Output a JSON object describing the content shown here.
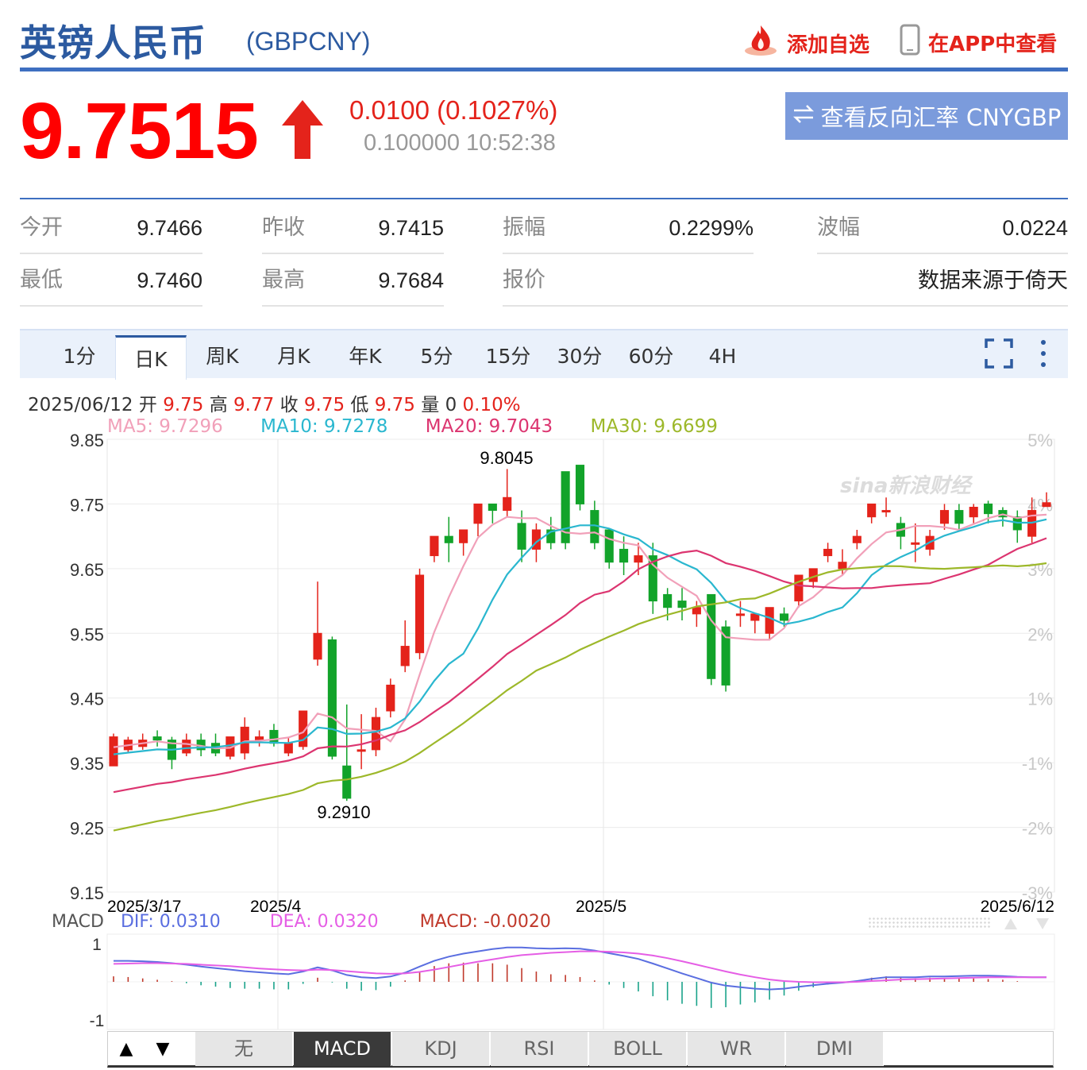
{
  "header": {
    "title": "英镑人民币",
    "code": "(GBPCNY)",
    "add_label": "添加自选",
    "app_label": "在APP中查看"
  },
  "quote": {
    "price": "9.7515",
    "change": "0.0100 (0.1027%)",
    "sub": "0.100000 10:52:38",
    "reverse_label": "查看反向汇率 CNYGBP"
  },
  "stats": [
    {
      "label": "今开",
      "value": "9.7466"
    },
    {
      "label": "昨收",
      "value": "9.7415"
    },
    {
      "label": "振幅",
      "value": "0.2299%"
    },
    {
      "label": "波幅",
      "value": "0.0224"
    },
    {
      "label": "最低",
      "value": "9.7460"
    },
    {
      "label": "最高",
      "value": "9.7684"
    },
    {
      "label": "报价",
      "value": ""
    },
    {
      "label": "",
      "value": "数据来源于倚天"
    }
  ],
  "tabs": [
    "1分",
    "日K",
    "周K",
    "月K",
    "年K",
    "5分",
    "15分",
    "30分",
    "60分",
    "4H"
  ],
  "active_tab": "日K",
  "info": {
    "date": "2025/06/12",
    "open_label": "开",
    "open": "9.75",
    "high_label": "高",
    "high": "9.77",
    "close_label": "收",
    "close": "9.75",
    "low_label": "低",
    "low": "9.75",
    "vol_label": "量",
    "vol": "0",
    "pct": "0.10%"
  },
  "ma": [
    {
      "label": "MA5: 9.7296",
      "color": "#f1a0b9"
    },
    {
      "label": "MA10: 9.7278",
      "color": "#2ab7cf"
    },
    {
      "label": "MA20: 9.7043",
      "color": "#dc3570"
    },
    {
      "label": "MA30: 9.6699",
      "color": "#9db82a"
    }
  ],
  "macd_legend": {
    "name": "MACD",
    "dif": "DIF: 0.0310",
    "dea": "DEA: 0.0320",
    "macd": "MACD: -0.0020",
    "dif_color": "#5a6ee0",
    "dea_color": "#e55ee5",
    "macd_color": "#c0392b"
  },
  "indicator_buttons": [
    "无",
    "MACD",
    "KDJ",
    "RSI",
    "BOLL",
    "WR",
    "DMI"
  ],
  "active_indicator": "MACD",
  "chart_data": {
    "type": "candlestick",
    "y_ticks": [
      "9.85",
      "9.75",
      "9.65",
      "9.55",
      "9.45",
      "9.35",
      "9.25",
      "9.15"
    ],
    "pct_ticks": [
      "5%",
      "4%",
      "3%",
      "2%",
      "1%",
      "-1%",
      "-2%",
      "-3%"
    ],
    "x_ticks": [
      "2025/3/17",
      "2025/4",
      "2025/5",
      "2025/6/12"
    ],
    "macd_ticks": [
      "1",
      "-1"
    ],
    "high_mark": "9.8045",
    "low_mark": "9.2910",
    "watermark": "sina新浪财经",
    "ylim": [
      9.15,
      9.85
    ],
    "candles": [
      [
        9.345,
        9.395,
        9.39,
        9.345
      ],
      [
        9.37,
        9.39,
        9.385,
        9.365
      ],
      [
        9.375,
        9.395,
        9.385,
        9.37
      ],
      [
        9.39,
        9.4,
        9.385,
        9.375
      ],
      [
        9.385,
        9.39,
        9.355,
        9.34
      ],
      [
        9.365,
        9.395,
        9.385,
        9.36
      ],
      [
        9.385,
        9.395,
        9.37,
        9.36
      ],
      [
        9.38,
        9.395,
        9.365,
        9.36
      ],
      [
        9.36,
        9.385,
        9.39,
        9.355
      ],
      [
        9.365,
        9.42,
        9.405,
        9.355
      ],
      [
        9.385,
        9.4,
        9.39,
        9.375
      ],
      [
        9.4,
        9.41,
        9.38,
        9.375
      ],
      [
        9.365,
        9.39,
        9.38,
        9.36
      ],
      [
        9.375,
        9.425,
        9.43,
        9.37
      ],
      [
        9.51,
        9.63,
        9.55,
        9.5
      ],
      [
        9.54,
        9.545,
        9.36,
        9.355
      ],
      [
        9.345,
        9.44,
        9.295,
        9.291
      ],
      [
        9.37,
        9.425,
        9.37,
        9.34
      ],
      [
        9.37,
        9.435,
        9.42,
        9.36
      ],
      [
        9.43,
        9.48,
        9.47,
        9.42
      ],
      [
        9.5,
        9.57,
        9.53,
        9.49
      ],
      [
        9.52,
        9.65,
        9.64,
        9.51
      ],
      [
        9.67,
        9.69,
        9.7,
        9.66
      ],
      [
        9.7,
        9.73,
        9.69,
        9.66
      ],
      [
        9.69,
        9.7,
        9.71,
        9.67
      ],
      [
        9.72,
        9.74,
        9.75,
        9.7
      ],
      [
        9.75,
        9.75,
        9.74,
        9.72
      ],
      [
        9.74,
        9.804,
        9.76,
        9.73
      ],
      [
        9.72,
        9.74,
        9.68,
        9.66
      ],
      [
        9.68,
        9.72,
        9.71,
        9.66
      ],
      [
        9.71,
        9.73,
        9.69,
        9.68
      ],
      [
        9.8,
        9.8,
        9.69,
        9.68
      ],
      [
        9.81,
        9.81,
        9.75,
        9.74
      ],
      [
        9.74,
        9.755,
        9.69,
        9.68
      ],
      [
        9.71,
        9.71,
        9.66,
        9.65
      ],
      [
        9.68,
        9.7,
        9.66,
        9.64
      ],
      [
        9.66,
        9.69,
        9.67,
        9.64
      ],
      [
        9.67,
        9.69,
        9.6,
        9.58
      ],
      [
        9.61,
        9.62,
        9.59,
        9.57
      ],
      [
        9.6,
        9.62,
        9.59,
        9.57
      ],
      [
        9.58,
        9.6,
        9.59,
        9.56
      ],
      [
        9.61,
        9.61,
        9.48,
        9.47
      ],
      [
        9.56,
        9.57,
        9.47,
        9.46
      ],
      [
        9.58,
        9.6,
        9.58,
        9.56
      ],
      [
        9.57,
        9.58,
        9.58,
        9.55
      ],
      [
        9.55,
        9.57,
        9.59,
        9.54
      ],
      [
        9.58,
        9.59,
        9.57,
        9.56
      ],
      [
        9.6,
        9.61,
        9.64,
        9.59
      ],
      [
        9.63,
        9.65,
        9.65,
        9.62
      ],
      [
        9.67,
        9.69,
        9.68,
        9.66
      ],
      [
        9.65,
        9.68,
        9.66,
        9.64
      ],
      [
        9.69,
        9.71,
        9.7,
        9.68
      ],
      [
        9.73,
        9.75,
        9.75,
        9.72
      ],
      [
        9.74,
        9.76,
        9.74,
        9.73
      ],
      [
        9.72,
        9.73,
        9.7,
        9.68
      ],
      [
        9.69,
        9.72,
        9.69,
        9.66
      ],
      [
        9.68,
        9.71,
        9.7,
        9.67
      ],
      [
        9.72,
        9.75,
        9.74,
        9.71
      ],
      [
        9.74,
        9.75,
        9.72,
        9.71
      ],
      [
        9.73,
        9.75,
        9.745,
        9.72
      ],
      [
        9.75,
        9.755,
        9.735,
        9.72
      ],
      [
        9.74,
        9.745,
        9.73,
        9.715
      ],
      [
        9.73,
        9.74,
        9.71,
        9.69
      ],
      [
        9.7,
        9.76,
        9.74,
        9.69
      ],
      [
        9.746,
        9.768,
        9.752,
        9.746
      ]
    ],
    "macd_dif": [
      0.55,
      0.55,
      0.54,
      0.52,
      0.49,
      0.45,
      0.4,
      0.36,
      0.32,
      0.28,
      0.25,
      0.22,
      0.2,
      0.27,
      0.38,
      0.3,
      0.18,
      0.12,
      0.1,
      0.14,
      0.24,
      0.4,
      0.55,
      0.66,
      0.74,
      0.8,
      0.86,
      0.9,
      0.9,
      0.88,
      0.87,
      0.88,
      0.87,
      0.82,
      0.75,
      0.68,
      0.6,
      0.48,
      0.35,
      0.22,
      0.1,
      -0.02,
      -0.1,
      -0.14,
      -0.18,
      -0.2,
      -0.18,
      -0.13,
      -0.09,
      -0.05,
      -0.02,
      0.02,
      0.08,
      0.12,
      0.12,
      0.12,
      0.14,
      0.14,
      0.15,
      0.16,
      0.16,
      0.15,
      0.13,
      0.12,
      0.12
    ],
    "macd_dea": [
      0.47,
      0.48,
      0.49,
      0.49,
      0.48,
      0.47,
      0.45,
      0.43,
      0.41,
      0.38,
      0.35,
      0.33,
      0.31,
      0.3,
      0.32,
      0.31,
      0.28,
      0.25,
      0.22,
      0.21,
      0.22,
      0.26,
      0.32,
      0.39,
      0.46,
      0.53,
      0.59,
      0.65,
      0.7,
      0.73,
      0.76,
      0.78,
      0.8,
      0.8,
      0.79,
      0.77,
      0.74,
      0.69,
      0.62,
      0.54,
      0.45,
      0.36,
      0.27,
      0.19,
      0.12,
      0.06,
      0.02,
      0.0,
      -0.01,
      -0.01,
      -0.01,
      0.0,
      0.02,
      0.04,
      0.06,
      0.07,
      0.08,
      0.09,
      0.1,
      0.11,
      0.12,
      0.12,
      0.12,
      0.12,
      0.12
    ]
  }
}
